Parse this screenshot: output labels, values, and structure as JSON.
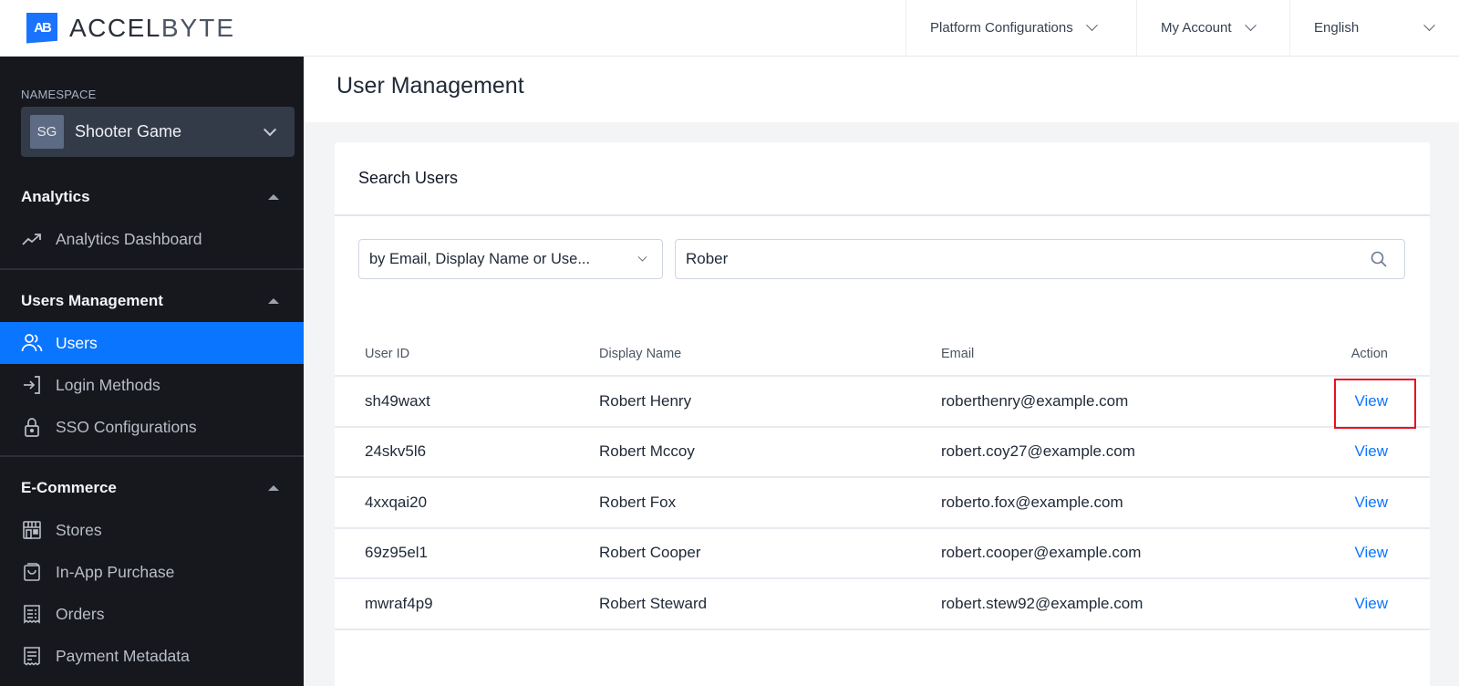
{
  "app": {
    "logo_mark": "AB",
    "logo_text_a": "ACCEL",
    "logo_text_b": "BYTE"
  },
  "topnav": {
    "items": [
      {
        "label": "Platform Configurations"
      },
      {
        "label": "My Account"
      },
      {
        "label": "English"
      }
    ]
  },
  "sidebar": {
    "namespace_label": "NAMESPACE",
    "namespace_badge": "SG",
    "namespace_name": "Shooter Game",
    "sections": [
      {
        "title": "Analytics",
        "items": [
          {
            "label": "Analytics Dashboard",
            "icon": "trending-up-icon"
          }
        ]
      },
      {
        "title": "Users Management",
        "items": [
          {
            "label": "Users",
            "icon": "users-icon",
            "active": true
          },
          {
            "label": "Login Methods",
            "icon": "login-icon"
          },
          {
            "label": "SSO Configurations",
            "icon": "lock-icon"
          }
        ]
      },
      {
        "title": "E-Commerce",
        "items": [
          {
            "label": "Stores",
            "icon": "store-icon"
          },
          {
            "label": "In-App Purchase",
            "icon": "shopping-bag-icon"
          },
          {
            "label": "Orders",
            "icon": "receipt-icon"
          },
          {
            "label": "Payment Metadata",
            "icon": "document-icon"
          }
        ]
      }
    ]
  },
  "page": {
    "title": "User Management"
  },
  "search": {
    "card_title": "Search Users",
    "filter_value": "by Email, Display Name or Use...",
    "query": "Rober"
  },
  "table": {
    "headers": [
      "User ID",
      "Display Name",
      "Email",
      "Action"
    ],
    "rows": [
      {
        "user_id": "sh49waxt",
        "display_name": "Robert Henry",
        "email": "roberthenry@example.com",
        "action": "View"
      },
      {
        "user_id": "24skv5l6",
        "display_name": "Robert Mccoy",
        "email": "robert.coy27@example.com",
        "action": "View"
      },
      {
        "user_id": "4xxqai20",
        "display_name": "Robert Fox",
        "email": "roberto.fox@example.com",
        "action": "View"
      },
      {
        "user_id": "69z95el1",
        "display_name": "Robert Cooper",
        "email": "robert.cooper@example.com",
        "action": "View"
      },
      {
        "user_id": "mwraf4p9",
        "display_name": "Robert Steward",
        "email": "robert.stew92@example.com",
        "action": "View"
      }
    ]
  },
  "colors": {
    "accent": "#0a75ff",
    "sidebar_bg": "#16181d",
    "highlight_box": "#e8121e"
  }
}
